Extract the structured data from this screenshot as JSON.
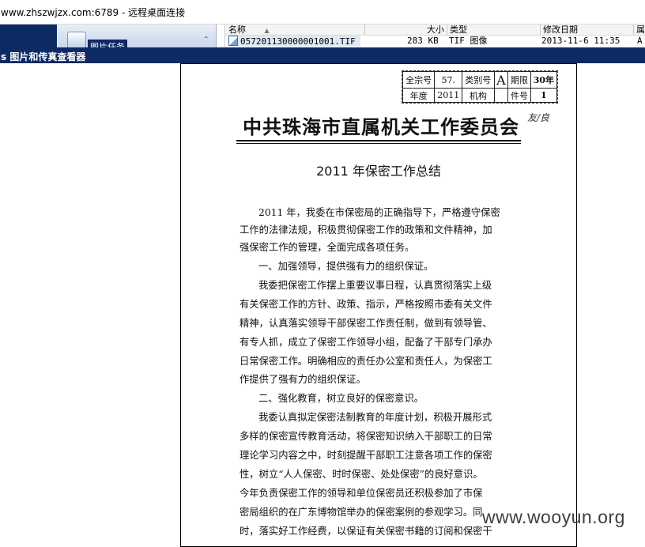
{
  "window": {
    "title": "www.zhszwjzx.com:6789 - 远程桌面连接"
  },
  "explorer": {
    "nav_label": "图片任务",
    "nav_chevron": "⌃",
    "columns": {
      "name": "名称",
      "size": "大小",
      "type": "类型",
      "modified": "修改日期",
      "attr": "属"
    },
    "files": [
      {
        "name": "057201130000001001.TIF",
        "size": "283 KB",
        "type": "TIF 图像",
        "modified": "2013-11-6 11:35",
        "attr": "A"
      }
    ]
  },
  "viewer": {
    "title": "s 图片和传真查看器"
  },
  "document": {
    "stamp": {
      "quanzonghao_label": "全宗号",
      "quanzonghao_value": "57.",
      "leibiehao_label": "类别号",
      "leibiehao_value": "A",
      "qixian_label": "期限",
      "qixian_value": "30年",
      "niandu_label": "年度",
      "niandu_value": "2011",
      "jigou_label": "机构",
      "jigou_value": "",
      "jianhao_label": "件号",
      "jianhao_value": "1"
    },
    "signature": "友/良",
    "org_name": "中共珠海市直属机关工作委员会",
    "title": "2011 年保密工作总结",
    "lines": [
      "2011 年，我委在市保密局的正确指导下，严格遵守保密",
      "工作的法律法规，积极贯彻保密工作的政策和文件精神，加",
      "强保密工作的管理，全面完成各项任务。",
      "一、加强领导，提供强有力的组织保证。",
      "我委把保密工作摆上重要议事日程，认真贯彻落实上级",
      "有关保密工作的方针、政策、指示，严格按照市委有关文件",
      "精神，认真落实领导干部保密工作责任制，做到有领导管、",
      "有专人抓，成立了保密工作领导小组，配备了干部专门承办",
      "日常保密工作。明确相应的责任办公室和责任人，为保密工",
      "作提供了强有力的组织保证。",
      "二、强化教育，树立良好的保密意识。",
      "我委认真拟定保密法制教育的年度计划，积极开展形式",
      "多样的保密宣传教育活动，将保密知识纳入干部职工的日常",
      "理论学习内容之中，时刻提醒干部职工注意各项工作的保密",
      "性，树立“人人保密、时时保密、处处保密”的良好意识。",
      "今年负责保密工作的领导和单位保密员还积极参加了市保",
      "密局组织的在广东博物馆举办的保密案例的参观学习。同",
      "时，落实好工作经费，以保证有关保密书籍的订阅和保密干"
    ]
  },
  "watermark": "www.wooyun.org"
}
